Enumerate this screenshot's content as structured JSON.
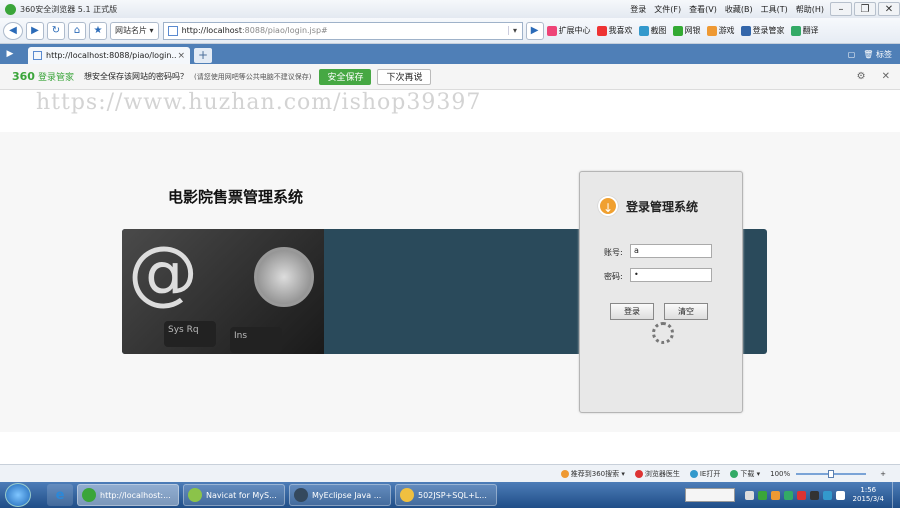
{
  "titlebar": {
    "title": "360安全浏览器 5.1 正式版",
    "menus": [
      "登录",
      "文件(F)",
      "查看(V)",
      "收藏(B)",
      "工具(T)",
      "帮助(H)"
    ],
    "minimize": "–",
    "maximize": "❐",
    "close": "✕"
  },
  "navbar": {
    "back": "◀",
    "forward": "▶",
    "refresh": "↻",
    "home": "⌂",
    "star": "★",
    "favorites": "网站名片 ▾",
    "url_host": "http://localhost",
    "url_path": ":8088/piao/login.jsp#",
    "drop": "▾",
    "go": "▶",
    "tools": [
      "扩展中心",
      "我喜欢",
      "截图",
      "网银",
      "游戏",
      "登录管家",
      "翻译"
    ]
  },
  "tabbar": {
    "tab_label": "http://localhost:8088/piao/login...",
    "tab_close": "×",
    "new_tab": "+",
    "right_items": [
      "▢",
      "🗑 标签"
    ]
  },
  "password_bar": {
    "brand": "360",
    "brand2": "登录管家",
    "question": "想安全保存该网站的密码吗？",
    "note": "(请您使用网吧等公共电脑不建议保存)",
    "save_label": "安全保存",
    "later_label": "下次再说",
    "gear": "⚙",
    "close": "✕"
  },
  "page": {
    "watermark": "https://www.huzhan.com/ishop39397",
    "system_name": "电影院售票管理系统",
    "banner_at": "@",
    "banner_key1": "Sys Rq",
    "banner_key2": "Ins",
    "login": {
      "title": "登录管理系统",
      "icon": "↓",
      "account_label": "账号:",
      "account_value": "a",
      "password_label": "密码:",
      "password_value": "•",
      "login_button": "登录",
      "clear_button": "清空"
    }
  },
  "statusbar": {
    "items": [
      "推荐到360搜索 ▾",
      "浏览器医生",
      "IE打开",
      "下载 ▾"
    ],
    "zoom": "100%",
    "zoom_level": 0.5
  },
  "taskbar": {
    "tasks": [
      {
        "label": "http://localhost:...",
        "color": "#3aa53a"
      },
      {
        "label": "Navicat for MyS...",
        "color": "#8bc34a"
      },
      {
        "label": "MyEclipse Java ...",
        "color": "#34495e"
      },
      {
        "label": "502JSP+SQL+L...",
        "color": "#f0c040"
      }
    ],
    "time": "1:56",
    "date": "2015/3/4"
  }
}
